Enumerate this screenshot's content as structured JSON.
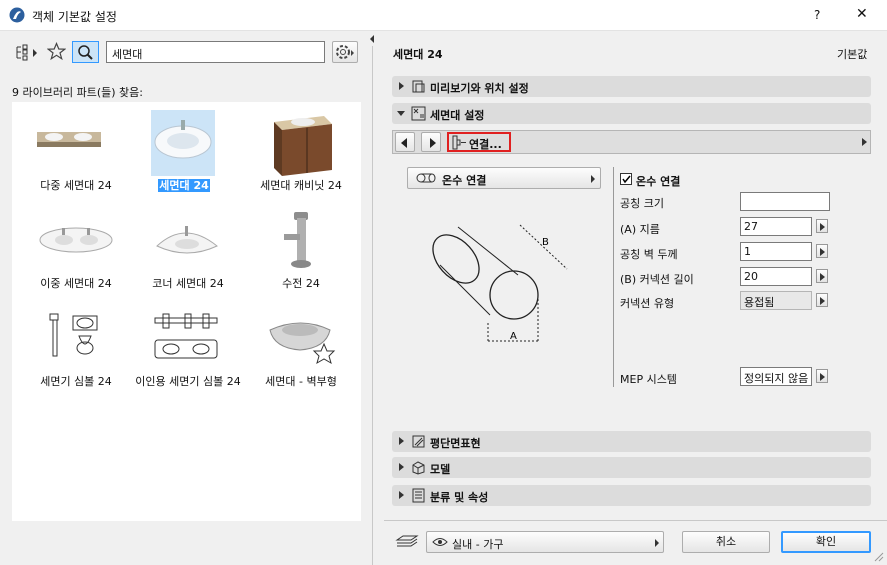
{
  "window": {
    "title": "객체 기본값 설정",
    "help": "?",
    "close": "✕"
  },
  "search": {
    "value": "세면대",
    "result_count": "9 라이브러리 파트(들) 찾음:"
  },
  "library_items": [
    {
      "label": "다중 세면대 24",
      "selected": false
    },
    {
      "label": "세면대 24",
      "selected": true
    },
    {
      "label": "세면대 캐비닛 24",
      "selected": false
    },
    {
      "label": "이중 세면대 24",
      "selected": false
    },
    {
      "label": "코너 세면대 24",
      "selected": false
    },
    {
      "label": "수전 24",
      "selected": false
    },
    {
      "label": "세면기 심볼 24",
      "selected": false
    },
    {
      "label": "이인용 세면기 심볼 24",
      "selected": false
    },
    {
      "label": "세면대 - 벽부형",
      "selected": false
    }
  ],
  "header": {
    "object_name": "세면대 24",
    "default_label": "기본값"
  },
  "panels": {
    "preview": "미리보기와 위치 설정",
    "settings": "세면대 설정",
    "floor_plan": "평단면표현",
    "model": "모델",
    "classification": "분류 및 속성"
  },
  "tab_nav": {
    "current": "연결..."
  },
  "connection": {
    "button_label": "온수 연결",
    "checkbox_label": "온수 연결",
    "checked": true,
    "params": [
      {
        "label": "공칭 크기",
        "value": ""
      },
      {
        "label": "(A) 지름",
        "value": "27"
      },
      {
        "label": "공칭 벽 두께",
        "value": "1"
      },
      {
        "label": "(B) 커넥션 길이",
        "value": "20"
      },
      {
        "label": "커넥션 유형",
        "value": "용접됨"
      }
    ],
    "mep_label": "MEP 시스템",
    "mep_value": "정의되지 않음",
    "diagram_labels": {
      "a": "A",
      "b": "B"
    }
  },
  "footer": {
    "layer": "실내 - 가구",
    "cancel": "취소",
    "ok": "확인"
  },
  "colors": {
    "accent": "#3399ff",
    "highlight": "#e02020",
    "selection": "#cce4f7"
  }
}
